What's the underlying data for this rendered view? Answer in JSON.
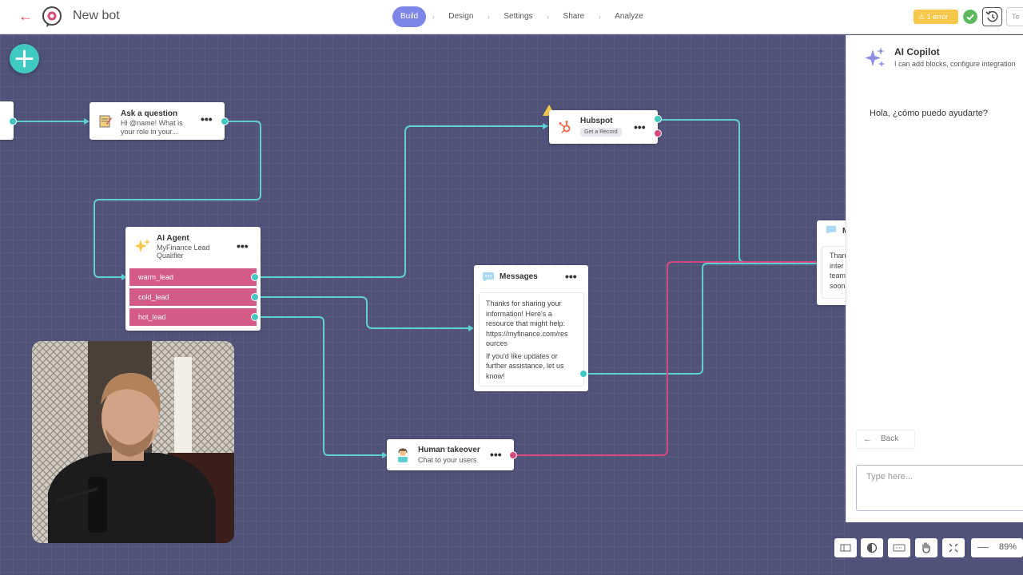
{
  "header": {
    "bot_name": "New bot",
    "tabs": [
      {
        "label": "Build",
        "active": true
      },
      {
        "label": "Design",
        "active": false
      },
      {
        "label": "Settings",
        "active": false
      },
      {
        "label": "Share",
        "active": false
      },
      {
        "label": "Analyze",
        "active": false
      }
    ],
    "error_badge": "1 error",
    "test_label": "Te"
  },
  "nodes": {
    "ask_question": {
      "title": "Ask a question",
      "sub_line1": "Hi @name! What is",
      "sub_line2": "your role in your..."
    },
    "hubspot": {
      "title": "Hubspot",
      "action": "Get a Record"
    },
    "ai_agent": {
      "title": "AI Agent",
      "sub_line1": "MyFinance Lead",
      "sub_line2": "Qualifier",
      "intents": [
        "warm_lead",
        "cold_lead",
        "hot_lead"
      ]
    },
    "messages": {
      "title": "Messages",
      "para1_line1": "Thanks for sharing your",
      "para1_line2": "information! Here's a",
      "para1_line3": "resource that might help:",
      "para1_line4": "https://myfinance.com/res",
      "para1_line5": "ources",
      "para2_line1": "If you'd like updates or",
      "para2_line2": "further assistance, let us",
      "para2_line3": "know!"
    },
    "human_takeover": {
      "title": "Human takeover",
      "sub": "Chat to your users"
    },
    "partial_right": {
      "title": "M",
      "lines": [
        "Than",
        "inter",
        "team",
        "soon"
      ]
    }
  },
  "copilot": {
    "title": "AI Copilot",
    "subtitle": "I can add blocks, configure integration",
    "greeting": "Hola, ¿cómo puedo ayudarte?",
    "back_label": "Back",
    "input_placeholder": "Type here..."
  },
  "toolbar": {
    "icons": [
      "sidebar-toggle-icon",
      "contrast-icon",
      "keyboard-icon",
      "hand-pan-icon",
      "fit-screen-icon"
    ],
    "zoom_minus": "—",
    "zoom_level": "89%"
  },
  "colors": {
    "accent": "#7e85e8",
    "canvas": "#50527a",
    "edge_teal": "#5ed0d2",
    "edge_red": "#d84a7b",
    "intent_pink": "#d45a87",
    "error_yellow": "#f5c84c",
    "add_button": "#3fc9c1"
  }
}
